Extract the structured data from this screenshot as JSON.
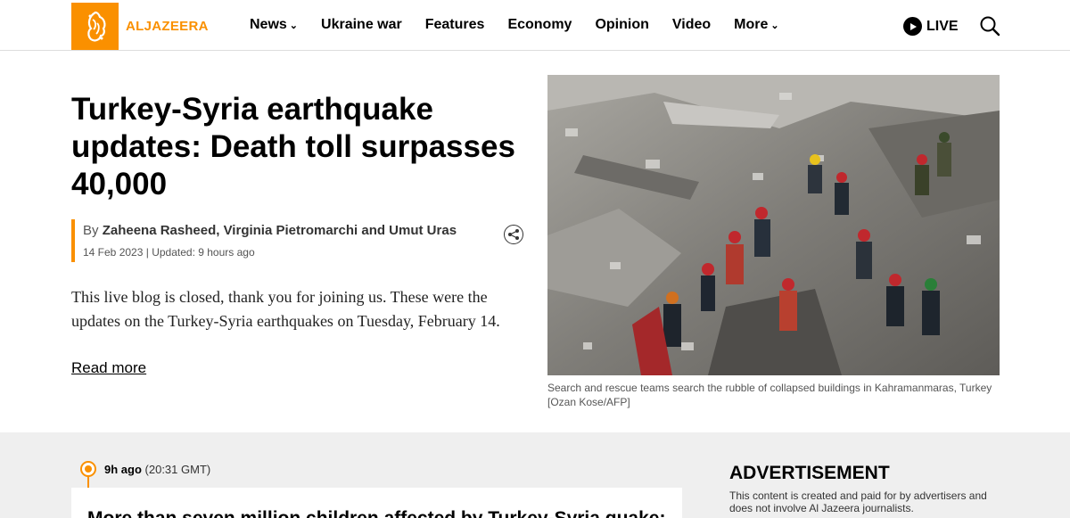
{
  "brand": {
    "name": "ALJAZEERA",
    "color": "#fa9000"
  },
  "nav": {
    "items": [
      {
        "label": "News",
        "dropdown": true
      },
      {
        "label": "Ukraine war",
        "dropdown": false
      },
      {
        "label": "Features",
        "dropdown": false
      },
      {
        "label": "Economy",
        "dropdown": false
      },
      {
        "label": "Opinion",
        "dropdown": false
      },
      {
        "label": "Video",
        "dropdown": false
      },
      {
        "label": "More",
        "dropdown": true
      }
    ],
    "live_label": "LIVE"
  },
  "article": {
    "title": "Turkey-Syria earthquake updates: Death toll surpasses 40,000",
    "by_prefix": "By",
    "authors": "Zaheena Rasheed, Virginia Pietromarchi and Umut Uras",
    "date": "14 Feb 2023",
    "separator": "|",
    "updated": "Updated: 9 hours ago",
    "summary": "This live blog is closed, thank you for joining us. These were the updates on the Turkey-Syria earthquakes on Tuesday, February 14.",
    "read_more": "Read more",
    "caption": "Search and rescue teams search the rubble of collapsed buildings in Kahramanmaras, Turkey [Ozan Kose/AFP]"
  },
  "live_feed": {
    "time_ago": "9h ago",
    "time_gmt": "(20:31 GMT)",
    "first_post_title": "More than seven million children affected by Turkey-Syria quake:"
  },
  "advertisement": {
    "title": "ADVERTISEMENT",
    "text": "This content is created and paid for by advertisers and does not involve Al Jazeera journalists."
  }
}
